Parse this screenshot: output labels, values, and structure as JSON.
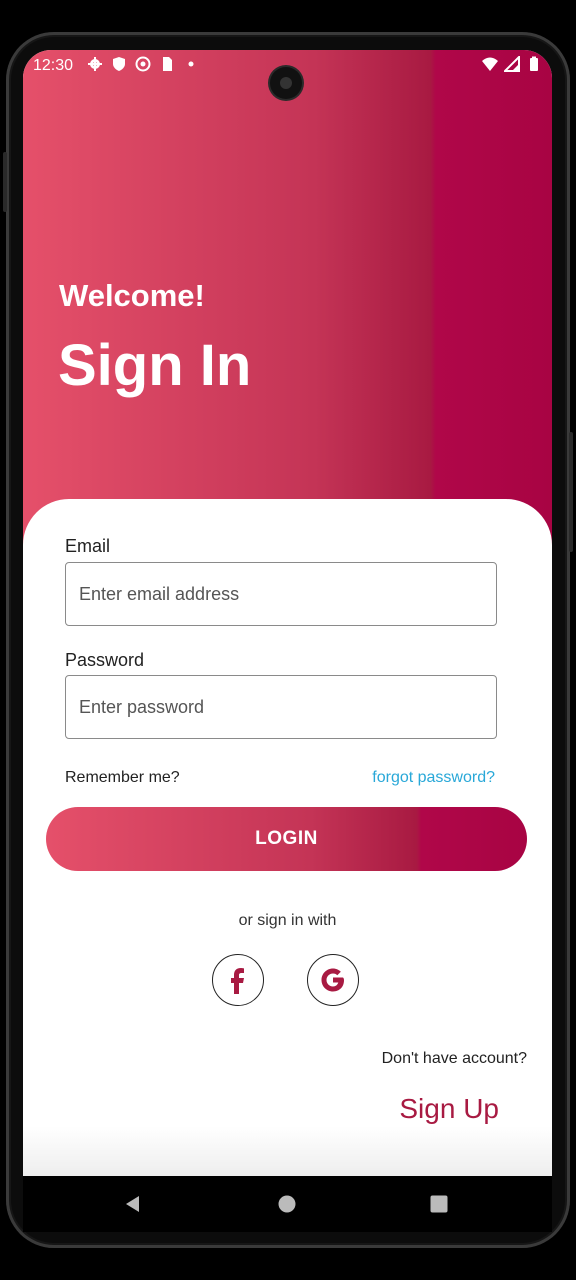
{
  "status_bar": {
    "time": "12:30",
    "left_icons": [
      "settings-icon",
      "shield-icon",
      "vpn-icon",
      "sim-icon",
      "dot-icon"
    ],
    "right_icons": [
      "wifi-icon",
      "signal-icon",
      "battery-icon"
    ]
  },
  "hero": {
    "welcome": "Welcome!",
    "title": "Sign In"
  },
  "form": {
    "email_label": "Email",
    "email_placeholder": "Enter email address",
    "email_value": "",
    "password_label": "Password",
    "password_placeholder": "Enter password",
    "password_value": "",
    "remember_label": "Remember me?",
    "forgot_label": "forgot password?",
    "login_label": "LOGIN"
  },
  "social": {
    "prompt": "or sign in with",
    "providers": [
      "facebook-icon",
      "google-icon"
    ]
  },
  "footer": {
    "no_account": "Don't have account?",
    "signup_label": "Sign Up"
  },
  "colors": {
    "accent_start": "#e5506a",
    "accent_end": "#a80443",
    "link": "#29a8d8"
  }
}
